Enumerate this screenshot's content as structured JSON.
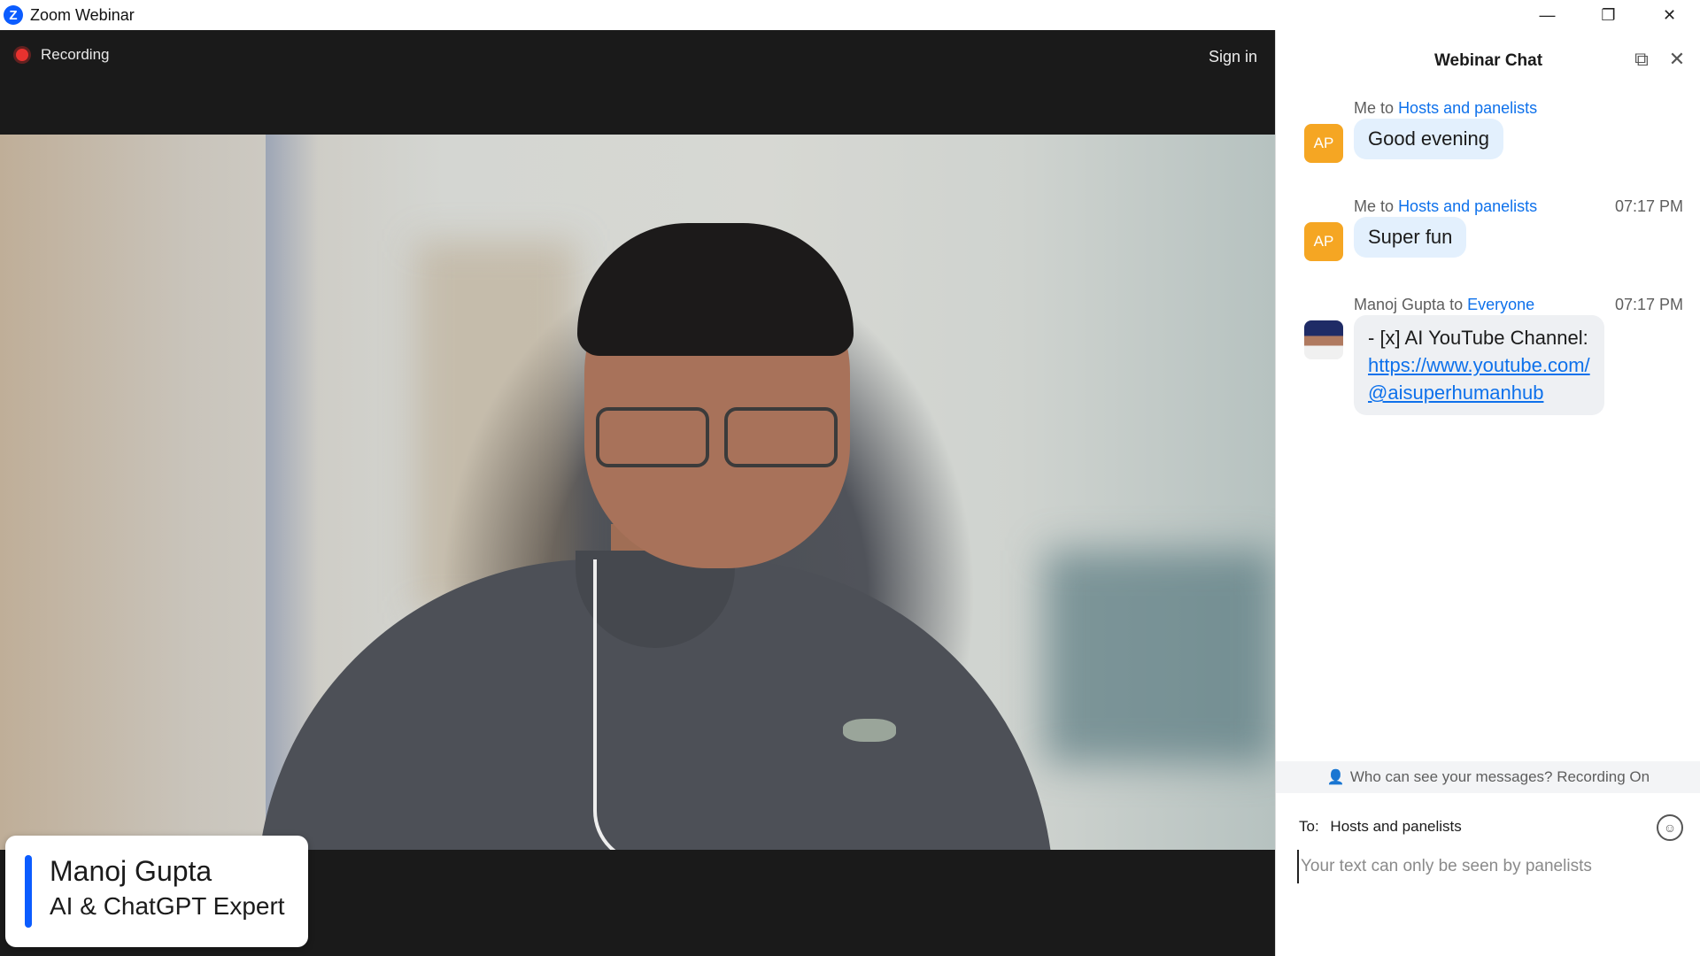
{
  "window": {
    "title": "Zoom Webinar",
    "logo_letter": "Z",
    "minimize_icon": "—",
    "restore_icon": "❐",
    "close_icon": "✕"
  },
  "video": {
    "recording_label": "Recording",
    "sign_in_label": "Sign in",
    "speaker_name": "Manoj Gupta",
    "speaker_title": "AI & ChatGPT Expert"
  },
  "chat": {
    "title": "Webinar Chat",
    "popout_icon": "⧉",
    "close_icon": "✕",
    "messages": [
      {
        "sender": "Me",
        "to_word": "to",
        "recipient": "Hosts and panelists",
        "time": "",
        "avatar_initials": "AP",
        "text": "Good evening"
      },
      {
        "sender": "Me",
        "to_word": "to",
        "recipient": "Hosts and panelists",
        "time": "07:17 PM",
        "avatar_initials": "AP",
        "text": "Super fun"
      },
      {
        "sender": "Manoj Gupta",
        "to_word": "to",
        "recipient": "Everyone",
        "time": "07:17 PM",
        "avatar_initials": "",
        "text_line1": "- [x] AI YouTube Channel:",
        "link_line1": "https://www.youtube.com/",
        "link_line2": "@aisuperhumanhub"
      }
    ],
    "visibility_text": "Who can see your messages? Recording On",
    "to_label": "To:",
    "to_value": "Hosts and panelists",
    "emoji_icon": "☺",
    "input_placeholder": "Your text can only be seen by panelists"
  },
  "colors": {
    "accent": "#0b5cff",
    "link": "#0e71eb",
    "avatar": "#f5a623",
    "recording": "#e8322f"
  }
}
